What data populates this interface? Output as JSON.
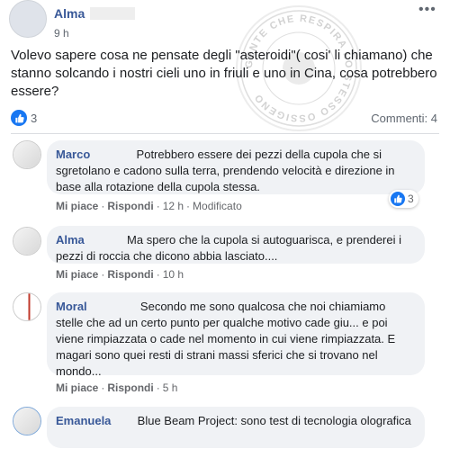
{
  "post": {
    "author": "Alma",
    "time": "9 h",
    "text": "Volevo sapere cosa ne pensate degli \"asteroidi\"( cosi' li chiamano) che stanno solcando i nostri cieli uno in friuli e uno in Cina, cosa potrebbero essere?",
    "like_count": "3",
    "comments_label": "Commenti: 4",
    "more_icon": "more-dots-icon",
    "watermark_text": "GENTE CHE RESPIRA LO STESSO OSSIGENO"
  },
  "comments": [
    {
      "author": "Marco",
      "text": "Potrebbero essere dei pezzi della cupola che si sgretolano e cadono sulla terra, prendendo velocità e direzione in base alla rotazione della cupola stessa.",
      "like": "Mi piace",
      "reply": "Rispondi",
      "time": "12 h",
      "edited": "Modificato",
      "reactions": "3"
    },
    {
      "author": "Alma",
      "text": "Ma spero che la cupola si autoguarisca, e prenderei i pezzi di roccia che dicono abbia lasciato....",
      "like": "Mi piace",
      "reply": "Rispondi",
      "time": "10 h"
    },
    {
      "author": "Moral",
      "text": "Secondo me sono qualcosa che noi chiamiamo stelle che ad un certo punto per qualche motivo cade giu... e poi viene rimpiazzata o cade nel momento in cui viene rimpiazzata. E magari sono quei resti di strani massi sferici che si trovano nel mondo...",
      "like": "Mi piace",
      "reply": "Rispondi",
      "time": "5 h"
    },
    {
      "author": "Emanuela",
      "text": "Blue Beam Project: sono test di tecnologia olografica"
    }
  ],
  "colors": {
    "name": "#385898",
    "like_blue": "#1877f2",
    "bubble": "#f0f2f5",
    "meta": "#65676b"
  }
}
